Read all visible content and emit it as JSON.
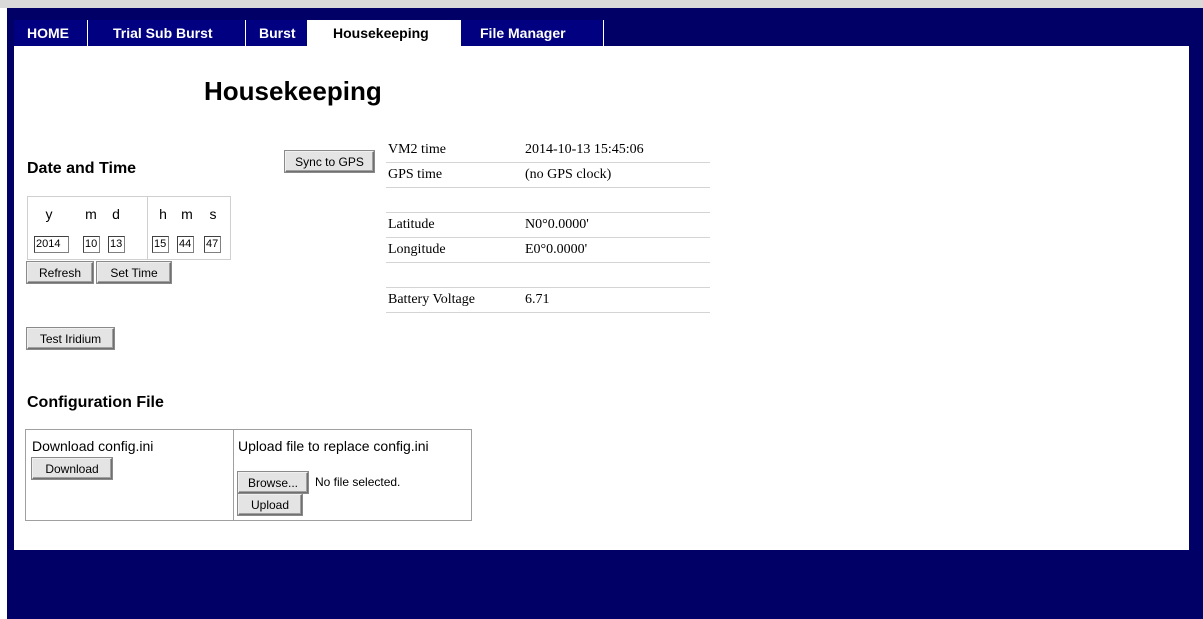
{
  "nav": {
    "tabs": [
      {
        "label": "HOME",
        "active": false
      },
      {
        "label": "Trial Sub Burst",
        "active": false
      },
      {
        "label": "Burst",
        "active": false
      },
      {
        "label": "Housekeeping",
        "active": true
      },
      {
        "label": "File Manager",
        "active": false
      }
    ]
  },
  "page": {
    "title": "Housekeeping"
  },
  "datetime": {
    "heading": "Date and Time",
    "sync_label": "Sync to GPS",
    "labels": {
      "y": "y",
      "mo": "m",
      "d": "d",
      "h": "h",
      "mi": "m",
      "s": "s"
    },
    "values": {
      "y": "2014",
      "mo": "10",
      "d": "13",
      "h": "15",
      "mi": "44",
      "s": "47"
    },
    "refresh_label": "Refresh",
    "set_time_label": "Set Time"
  },
  "status": {
    "vm2_label": "VM2 time",
    "vm2_value": "2014-10-13 15:45:06",
    "gps_label": "GPS time",
    "gps_value": "(no GPS clock)",
    "lat_label": "Latitude",
    "lat_value": "N0°0.0000'",
    "lon_label": "Longitude",
    "lon_value": "E0°0.0000'",
    "batt_label": "Battery Voltage",
    "batt_value": "6.71"
  },
  "iridium": {
    "test_label": "Test Iridium"
  },
  "config": {
    "heading": "Configuration File",
    "download_text": "Download config.ini",
    "download_label": "Download",
    "upload_text": "Upload file to replace config.ini",
    "browse_label": "Browse...",
    "file_status": "No file selected.",
    "upload_label": "Upload"
  },
  "colors": {
    "frame": "#000066",
    "tab_bg": "#000080",
    "active_tab_bg": "#ffffff"
  }
}
